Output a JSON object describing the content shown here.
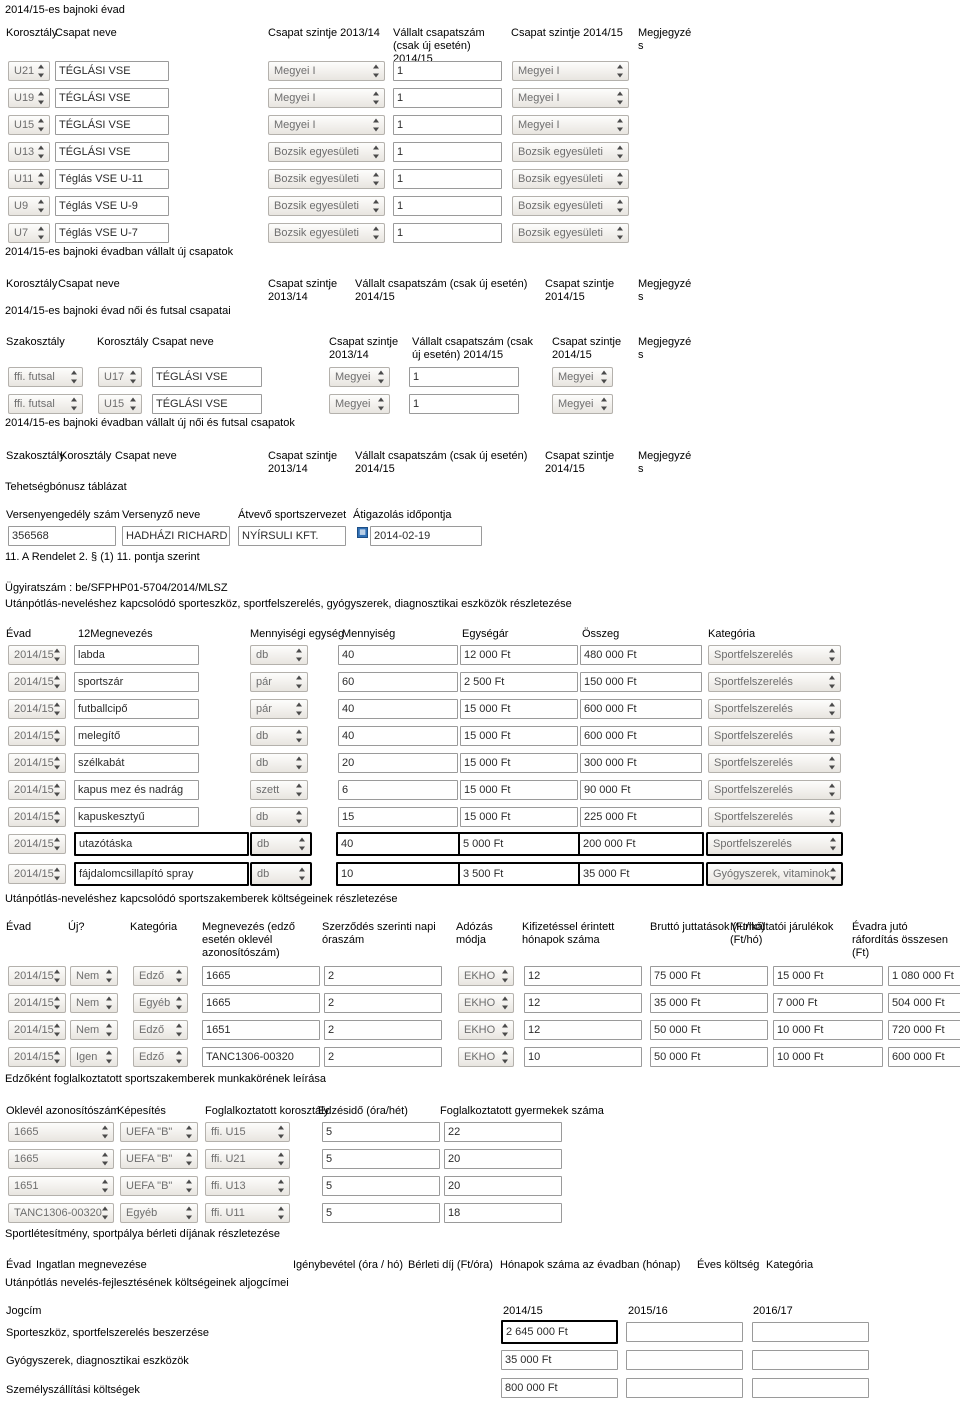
{
  "document": {
    "top_title": "2014/15-es bajnoki évad"
  },
  "season_teams": {
    "headers": {
      "korosztaly": "Korosztály",
      "csapat_neve": "Csapat neve",
      "szint_1314": "Csapat szintje 2013/14",
      "vallalt": "Vállalt csapatszám (csak\núj esetén) 2014/15",
      "szint_1415": "Csapat szintje 2014/15",
      "megjegyzes": "Megjegyzé\ns"
    },
    "rows": [
      {
        "korosztaly": "U21",
        "nev": "TÉGLÁSI VSE",
        "szint1314": "Megyei I",
        "vallalt": "1",
        "szint1415": "Megyei I"
      },
      {
        "korosztaly": "U19",
        "nev": "TÉGLÁSI VSE",
        "szint1314": "Megyei I",
        "vallalt": "1",
        "szint1415": "Megyei I"
      },
      {
        "korosztaly": "U15",
        "nev": "TÉGLÁSI VSE",
        "szint1314": "Megyei I",
        "vallalt": "1",
        "szint1415": "Megyei I"
      },
      {
        "korosztaly": "U13",
        "nev": "TÉGLÁSI VSE",
        "szint1314": "Bozsik egyesületi",
        "vallalt": "1",
        "szint1415": "Bozsik egyesületi"
      },
      {
        "korosztaly": "U11",
        "nev": "Téglás VSE U-11",
        "szint1314": "Bozsik egyesületi",
        "vallalt": "1",
        "szint1415": "Bozsik egyesületi"
      },
      {
        "korosztaly": "U9",
        "nev": "Téglás VSE U-9",
        "szint1314": "Bozsik egyesületi",
        "vallalt": "1",
        "szint1415": "Bozsik egyesületi"
      },
      {
        "korosztaly": "U7",
        "nev": "Téglás VSE U-7",
        "szint1314": "Bozsik egyesületi",
        "vallalt": "1",
        "szint1415": "Bozsik egyesületi"
      }
    ]
  },
  "new_teams": {
    "title": "2014/15-es bajnoki évadban vállalt új csapatok",
    "headers": {
      "korosztaly": "Korosztály",
      "csapat_neve": "Csapat neve",
      "szint_1314": "Csapat szintje\n2013/14",
      "vallalt": "Vállalt csapatszám (csak új esetén)\n2014/15",
      "szint_1415": "Csapat szintje\n2014/15",
      "megjegyzes": "Megjegyzé\ns"
    }
  },
  "futsal_teams": {
    "title": "2014/15-es bajnoki évad női és futsal csapatai",
    "headers": {
      "szakosztaly": "Szakosztály",
      "korosztaly": "Korosztály",
      "csapat_neve": "Csapat neve",
      "szint_1314": "Csapat szintje\n2013/14",
      "vallalt": "Vállalt csapatszám (csak új\nesetén) 2014/15",
      "szint_1415": "Csapat szintje\n2014/15",
      "megjegyzes": "Megjegyzé\ns"
    },
    "rows": [
      {
        "szakosztaly": "ffi. futsal",
        "korosztaly": "U17",
        "nev": "TÉGLÁSI VSE",
        "szint1314": "Megyei",
        "vallalt": "1",
        "szint1415": "Megyei"
      },
      {
        "szakosztaly": "ffi. futsal",
        "korosztaly": "U15",
        "nev": "TÉGLÁSI VSE",
        "szint1314": "Megyei",
        "vallalt": "1",
        "szint1415": "Megyei"
      }
    ]
  },
  "new_futsal_teams": {
    "title": "2014/15-es bajnoki évadban vállalt új női és futsal csapatok",
    "headers": {
      "szakosztaly": "Szakosztály",
      "korosztaly": "Korosztály",
      "csapat_neve": "Csapat neve",
      "szint_1314": "Csapat szintje\n2013/14",
      "vallalt": "Vállalt csapatszám (csak új esetén)\n2014/15",
      "szint_1415": "Csapat szintje\n2014/15",
      "megjegyzes": "Megjegyzé\ns"
    }
  },
  "talent_bonus": {
    "title": "Tehetségbónusz táblázat",
    "headers": {
      "engedely": "Versenyengedély szám",
      "versenyzo": "Versenyző neve",
      "atvevo": "Átvevő sportszervezet",
      "idopont": "Átigazolás időpontja"
    },
    "rows": [
      {
        "engedely": "356568",
        "versenyzo": "HADHÁZI RICHARD JÓ",
        "atvevo": "NYÍRSULI KFT.",
        "idopont": "2014-02-19"
      }
    ],
    "footnote": "11. A Rendelet 2. § (1) 11. pontja szerint"
  },
  "case_number": {
    "label": "Ügyiratszám : be/SFPHP01-5704/2014/MLSZ"
  },
  "equipment": {
    "title": "Utánpótlás-neveléshez kapcsolódó sporteszköz, sportfelszerelés, gyógyszerek, diagnosztikai eszközök részletezése",
    "headers": {
      "evad": "Évad",
      "megnevezes": "12Megnevezés",
      "egyseg": "Mennyiségi egység",
      "mennyiseg": "Mennyiség",
      "egysegar": "Egységár",
      "osszeg": "Összeg",
      "kategoria": "Kategória"
    },
    "rows": [
      {
        "evad": "2014/15",
        "megnevezes": "labda",
        "egyseg": "db",
        "mennyiseg": "40",
        "egysegar": "12 000 Ft",
        "osszeg": "480 000  Ft",
        "kategoria": "Sportfelszerelés",
        "highlight": false
      },
      {
        "evad": "2014/15",
        "megnevezes": "sportszár",
        "egyseg": "pár",
        "mennyiseg": "60",
        "egysegar": "2 500 Ft",
        "osszeg": "150 000  Ft",
        "kategoria": "Sportfelszerelés",
        "highlight": false
      },
      {
        "evad": "2014/15",
        "megnevezes": "futballcipő",
        "egyseg": "pár",
        "mennyiseg": "40",
        "egysegar": "15 000 Ft",
        "osszeg": "600 000  Ft",
        "kategoria": "Sportfelszerelés",
        "highlight": false
      },
      {
        "evad": "2014/15",
        "megnevezes": "melegítő",
        "egyseg": "db",
        "mennyiseg": "40",
        "egysegar": "15 000 Ft",
        "osszeg": "600 000  Ft",
        "kategoria": "Sportfelszerelés",
        "highlight": false
      },
      {
        "evad": "2014/15",
        "megnevezes": "szélkabát",
        "egyseg": "db",
        "mennyiseg": "20",
        "egysegar": "15 000 Ft",
        "osszeg": "300 000  Ft",
        "kategoria": "Sportfelszerelés",
        "highlight": false
      },
      {
        "evad": "2014/15",
        "megnevezes": "kapus mez és nadrág",
        "egyseg": "szett",
        "mennyiseg": "6",
        "egysegar": "15 000 Ft",
        "osszeg": "90 000  Ft",
        "kategoria": "Sportfelszerelés",
        "highlight": false
      },
      {
        "evad": "2014/15",
        "megnevezes": "kapuskesztyű",
        "egyseg": "db",
        "mennyiseg": "15",
        "egysegar": "15 000 Ft",
        "osszeg": "225 000  Ft",
        "kategoria": "Sportfelszerelés",
        "highlight": false
      },
      {
        "evad": "2014/15",
        "megnevezes": "utazótáska",
        "egyseg": "db",
        "mennyiseg": "40",
        "egysegar": "5 000 Ft",
        "osszeg": "200 000  Ft",
        "kategoria": "Sportfelszerelés",
        "highlight": true
      },
      {
        "evad": "2014/15",
        "megnevezes": "fájdalomcsillapító spray",
        "egyseg": "db",
        "mennyiseg": "10",
        "egysegar": "3 500 Ft",
        "osszeg": "35 000  Ft",
        "kategoria": "Gyógyszerek, vitaminok",
        "highlight": true
      }
    ]
  },
  "staff_costs": {
    "title": "Utánpótlás-neveléshez kapcsolódó sportszakemberek költségeinek részletezése",
    "headers": {
      "evad": "Évad",
      "uj": "Új?",
      "kategoria": "Kategória",
      "megnevezes": "Megnevezés (edző\nesetén oklevél\nazonosítószám)",
      "oraszam": "Szerződés szerinti napi\nóraszám",
      "adozas": "Adózás\nmódja",
      "honapok": "Kifizetéssel érintett\nhónapok száma",
      "brutto": "Bruttó juttatások (Ft/hó)",
      "jarulek": "Munkáltatói járulékok\n(Ft/hó)",
      "evadra": "Évadra jutó ráfordítás\nösszesen (Ft)"
    },
    "rows": [
      {
        "evad": "2014/15",
        "uj": "Nem",
        "kategoria": "Edző",
        "megnevezes": "1665",
        "oraszam": "2",
        "adozas": "EKHO",
        "honapok": "12",
        "brutto": "75 000 Ft",
        "jarulek": "15 000  Ft",
        "evadra": "1 080 000  Ft"
      },
      {
        "evad": "2014/15",
        "uj": "Nem",
        "kategoria": "Egyéb",
        "megnevezes": "1665",
        "oraszam": "2",
        "adozas": "EKHO",
        "honapok": "12",
        "brutto": "35 000 Ft",
        "jarulek": "7 000  Ft",
        "evadra": "504 000  Ft"
      },
      {
        "evad": "2014/15",
        "uj": "Nem",
        "kategoria": "Edző",
        "megnevezes": "1651",
        "oraszam": "2",
        "adozas": "EKHO",
        "honapok": "12",
        "brutto": "50 000 Ft",
        "jarulek": "10 000  Ft",
        "evadra": "720 000  Ft"
      },
      {
        "evad": "2014/15",
        "uj": "Igen",
        "kategoria": "Edző",
        "megnevezes": "TANC1306-00320",
        "oraszam": "2",
        "adozas": "EKHO",
        "honapok": "10",
        "brutto": "50 000 Ft",
        "jarulek": "10 000  Ft",
        "evadra": "600 000  Ft"
      }
    ]
  },
  "coach_jobs": {
    "title": "Edzőként foglalkoztatott sportszakemberek munkakörének leírása",
    "headers": {
      "oklevel": "Oklevél azonosítószám",
      "kepesites": "Képesítés",
      "korosztaly": "Foglalkoztatott korosztály",
      "edzesido": "Edzésidő (óra/hét)",
      "gyermekek": "Foglalkoztatott gyermekek száma"
    },
    "rows": [
      {
        "oklevel": "1665",
        "kepesites": "UEFA \"B\"",
        "korosztaly": "ffi. U15",
        "edzesido": "5",
        "gyermekek": "22"
      },
      {
        "oklevel": "1665",
        "kepesites": "UEFA \"B\"",
        "korosztaly": "ffi. U21",
        "edzesido": "5",
        "gyermekek": "20"
      },
      {
        "oklevel": "1651",
        "kepesites": "UEFA \"B\"",
        "korosztaly": "ffi. U13",
        "edzesido": "5",
        "gyermekek": "20"
      },
      {
        "oklevel": "TANC1306-00320",
        "kepesites": "Egyéb",
        "korosztaly": "ffi. U11",
        "edzesido": "5",
        "gyermekek": "18"
      }
    ]
  },
  "facility_rent": {
    "title": "Sportlétesítmény, sportpálya bérleti díjának részletezése",
    "headers": {
      "evad": "Évad",
      "ingatlan": "Ingatlan megnevezése",
      "igenybevetel": "Igénybevétel (óra / hó)",
      "berleti": "Bérleti díj (Ft/óra)",
      "honapok": "Hónapok száma az évadban (hónap)",
      "eves": "Éves költség",
      "kategoria": "Kategória"
    }
  },
  "subtitles": {
    "title": "Utánpótlás nevelés-fejlesztésének költségeinek aljogcímei",
    "headers": {
      "jogcim": "Jogcím",
      "y1": "2014/15",
      "y2": "2015/16",
      "y3": "2016/17"
    },
    "rows": [
      {
        "jogcim": "Sporteszköz, sportfelszerelés beszerzése",
        "y1": "2 645 000  Ft",
        "y2": "",
        "y3": "",
        "highlight": true
      },
      {
        "jogcim": "Gyógyszerek, diagnosztikai eszközök",
        "y1": "35 000  Ft",
        "y2": "",
        "y3": "",
        "highlight": false
      },
      {
        "jogcim": "Személyszállítási költségek",
        "y1": "800 000 Ft",
        "y2": "",
        "y3": "",
        "highlight": false
      }
    ]
  },
  "icons": {
    "date_picker": "date-picker-icon",
    "select_arrows": "updown-arrows-icon"
  }
}
